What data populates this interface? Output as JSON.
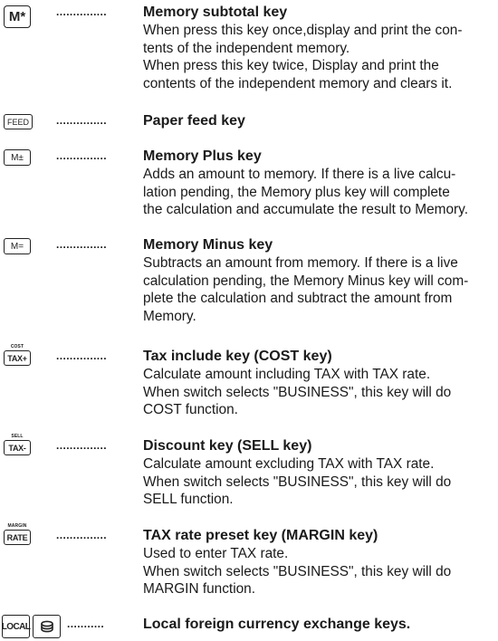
{
  "entries": [
    {
      "key_label": "M*",
      "dots": "...............",
      "title": "Memory subtotal key",
      "description": "When press this key once,display and print the con-\ntents of the independent memory.\nWhen press this key twice, Display and print the\ncontents of the independent memory and clears it."
    },
    {
      "key_label": "FEED",
      "dots": "...............",
      "title": "Paper feed key",
      "description": ""
    },
    {
      "key_label": "M±",
      "dots": "...............",
      "title": "Memory Plus key",
      "description": "Adds an amount to memory. If there is a live calcu-\nlation pending, the Memory plus key will complete\nthe calculation and accumulate the result to Memory."
    },
    {
      "key_label": "M=",
      "dots": "...............",
      "title": "Memory Minus key",
      "description": "Subtracts an amount from memory. If there is a live\ncalculation pending, the Memory Minus key will com-\nplete the calculation and subtract the amount from\nMemory."
    },
    {
      "key_top_label": "COST",
      "key_label": "TAX+",
      "dots": "...............",
      "title": "Tax include key (COST key)",
      "description": "Calculate amount including TAX with TAX rate.\n When switch selects \"BUSINESS\", this key will do\nCOST function."
    },
    {
      "key_top_label": "SELL",
      "key_label": "TAX-",
      "dots": "...............",
      "title": "Discount key (SELL key)",
      "description": "Calculate amount excluding TAX with TAX rate.\n When switch selects \"BUSINESS\", this key will do\nSELL function."
    },
    {
      "key_top_label": "MARGIN",
      "key_label": "RATE",
      "dots": "...............",
      "title": "TAX rate preset key (MARGIN key)",
      "description": "Used to enter TAX rate.\n When switch selects \"BUSINESS\", this key will do\nMARGIN function."
    },
    {
      "key_label": "LOCAL",
      "key2_icon": "coin-stack-icon",
      "dots": "...........",
      "title": "Local foreign currency exchange keys.",
      "description": ""
    }
  ]
}
